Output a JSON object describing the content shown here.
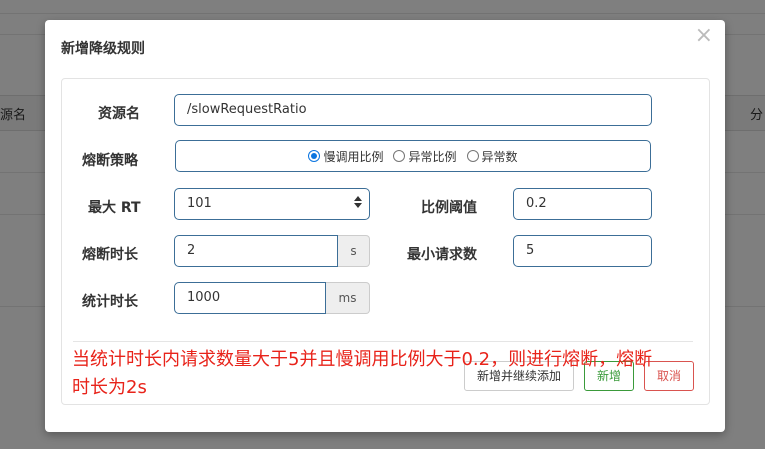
{
  "background": {
    "left_header": "源名",
    "right_header": "分"
  },
  "modal": {
    "title": "新增降级规则",
    "close_glyph": "×"
  },
  "form": {
    "resource": {
      "label": "资源名",
      "value": "/slowRequestRatio"
    },
    "strategy": {
      "label": "熔断策略",
      "options": [
        "慢调用比例",
        "异常比例",
        "异常数"
      ],
      "selected_index": 0
    },
    "max_rt": {
      "label": "最大 RT",
      "value": "101"
    },
    "ratio_threshold": {
      "label": "比例阈值",
      "value": "0.2"
    },
    "break_duration": {
      "label": "熔断时长",
      "value": "2",
      "unit": "s"
    },
    "min_requests": {
      "label": "最小请求数",
      "value": "5"
    },
    "stat_duration": {
      "label": "统计时长",
      "value": "1000",
      "unit": "ms"
    }
  },
  "buttons": {
    "save_continue": "新增并继续添加",
    "add": "新增",
    "cancel": "取消"
  },
  "annotation": "当统计时长内请求数量大于5并且慢调用比例大于0.2，则进行熔断，熔断时长为2s",
  "colors": {
    "input_border": "#3c6e97",
    "annotation": "#e8231a",
    "add_button": "#3a9a3a",
    "cancel_button": "#d9534f"
  }
}
